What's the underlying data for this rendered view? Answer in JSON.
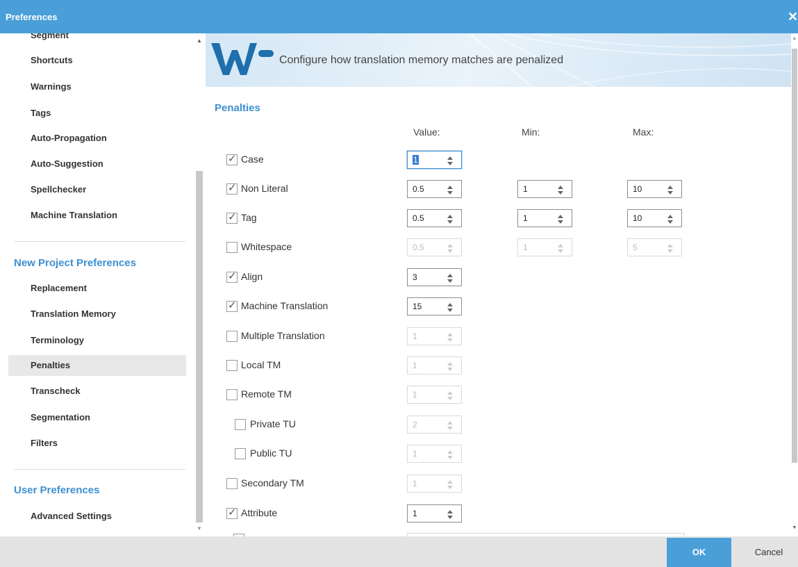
{
  "window": {
    "title": "Preferences",
    "close_icon": "close-icon"
  },
  "sidebar": {
    "items_top": [
      "Segment",
      "Shortcuts",
      "Warnings",
      "Tags",
      "Auto-Propagation",
      "Auto-Suggestion",
      "Spellchecker",
      "Machine Translation"
    ],
    "section_project": "New Project Preferences",
    "items_project": [
      "Replacement",
      "Translation Memory",
      "Terminology",
      "Penalties",
      "Transcheck",
      "Segmentation",
      "Filters"
    ],
    "selected": "Penalties",
    "section_user": "User Preferences",
    "items_user": [
      "Advanced Settings"
    ]
  },
  "banner": {
    "logo": "WF",
    "text": "Configure how translation memory matches are penalized"
  },
  "penalties": {
    "title": "Penalties",
    "columns": {
      "value": "Value:",
      "min": "Min:",
      "max": "Max:"
    },
    "rows": [
      {
        "label": "Case",
        "checked": true,
        "value": "1",
        "focused": true
      },
      {
        "label": "Non Literal",
        "checked": true,
        "value": "0.5",
        "min": "1",
        "max": "10"
      },
      {
        "label": "Tag",
        "checked": true,
        "value": "0.5",
        "min": "1",
        "max": "10"
      },
      {
        "label": "Whitespace",
        "checked": false,
        "value": "0.5",
        "min": "1",
        "max": "5"
      },
      {
        "label": "Align",
        "checked": true,
        "value": "3"
      },
      {
        "label": "Machine Translation",
        "checked": true,
        "value": "15"
      },
      {
        "label": "Multiple Translation",
        "checked": false,
        "value": "1"
      },
      {
        "label": "Local TM",
        "checked": false,
        "value": "1"
      },
      {
        "label": "Remote TM",
        "checked": false,
        "value": "1"
      },
      {
        "label": "Private TU",
        "checked": false,
        "value": "2",
        "indent": true
      },
      {
        "label": "Public TU",
        "checked": false,
        "value": "1",
        "indent": true
      },
      {
        "label": "Secondary TM",
        "checked": false,
        "value": "1"
      },
      {
        "label": "Attribute",
        "checked": true,
        "value": "1"
      }
    ]
  },
  "footer": {
    "ok_label": "OK",
    "cancel_label": "Cancel"
  },
  "colors": {
    "accent": "#4a9fd9",
    "section_text": "#3d8fd1",
    "logo": "#1f6fad"
  }
}
